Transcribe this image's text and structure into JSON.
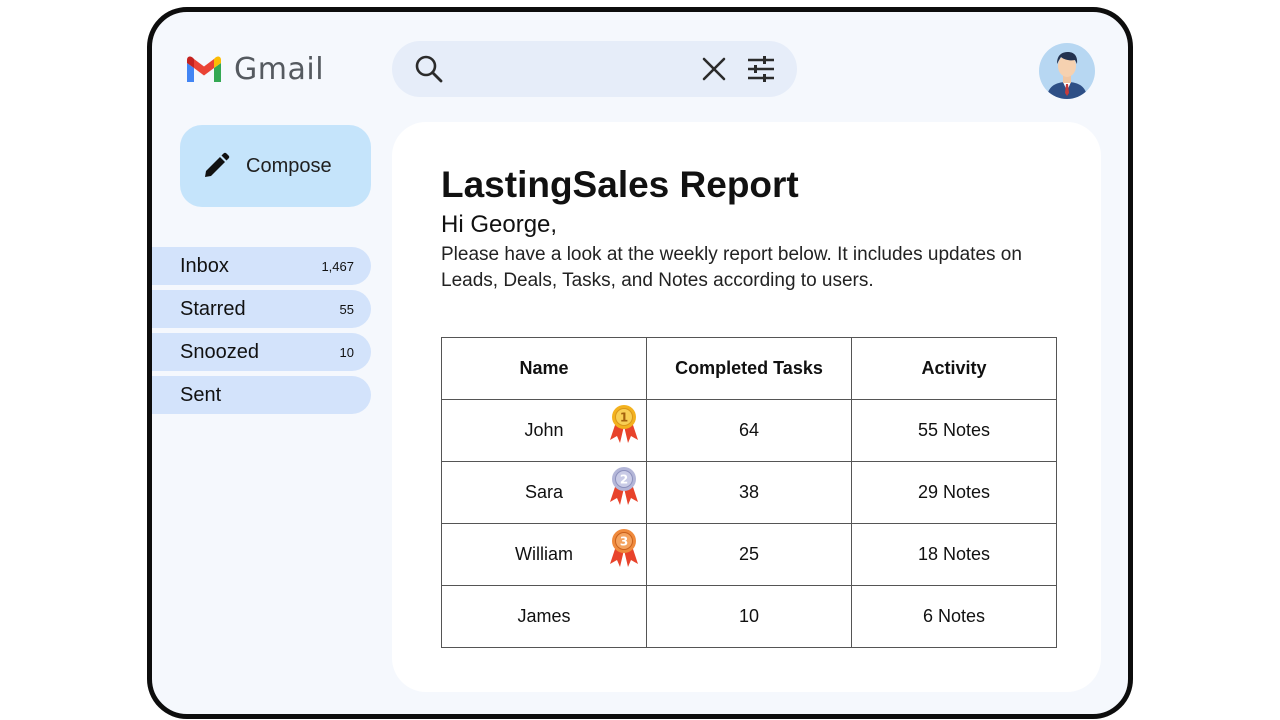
{
  "app": {
    "name": "Gmail"
  },
  "search": {
    "placeholder": ""
  },
  "compose": {
    "label": "Compose"
  },
  "sidebar": {
    "items": [
      {
        "label": "Inbox",
        "count": "1,467"
      },
      {
        "label": "Starred",
        "count": "55"
      },
      {
        "label": "Snoozed",
        "count": "10"
      },
      {
        "label": "Sent",
        "count": ""
      }
    ]
  },
  "email": {
    "title": "LastingSales Report",
    "greeting": "Hi George,",
    "body": "Please have a look at the weekly report below. It includes updates on Leads, Deals, Tasks, and Notes according to users.",
    "table": {
      "headers": [
        "Name",
        "Completed Tasks",
        "Activity"
      ],
      "rows": [
        {
          "name": "John",
          "tasks": "64",
          "activity": "55 Notes",
          "medal": "1"
        },
        {
          "name": "Sara",
          "tasks": "38",
          "activity": "29 Notes",
          "medal": "2"
        },
        {
          "name": "William",
          "tasks": "25",
          "activity": "18 Notes",
          "medal": "3"
        },
        {
          "name": "James",
          "tasks": "10",
          "activity": "6 Notes",
          "medal": ""
        }
      ]
    }
  },
  "colors": {
    "gold": "#f3b21f",
    "silver": "#b3b6d8",
    "bronze": "#ef8a3c",
    "ribbon": "#e8432b",
    "nav_bg": "#d3e3fb",
    "compose_bg": "#c5e4fb"
  }
}
